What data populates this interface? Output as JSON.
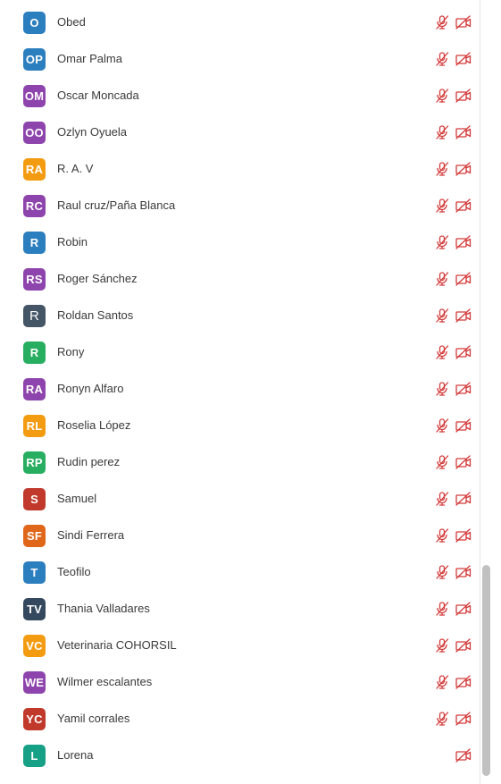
{
  "colors": {
    "blue": "#2c7fbf",
    "purple": "#8e44ad",
    "orange": "#f39c12",
    "slate": "#445566",
    "green": "#27ae60",
    "red": "#c0392b",
    "dark_orange": "#e0661a",
    "navy": "#34495e",
    "teal": "#16a085",
    "muted_icon": "#d33a3a"
  },
  "participants": [
    {
      "initials": "O",
      "name": "Obed",
      "color": "#2c7fbf",
      "mic_muted": true,
      "cam_off": true,
      "mic_icon": "microphone-muted-icon",
      "cam_icon": "camera-off-icon"
    },
    {
      "initials": "OP",
      "name": "Omar Palma",
      "color": "#2c7fbf",
      "mic_muted": true,
      "cam_off": true,
      "mic_icon": "microphone-muted-icon",
      "cam_icon": "camera-off-icon"
    },
    {
      "initials": "OM",
      "name": "Oscar Moncada",
      "color": "#8e44ad",
      "mic_muted": true,
      "cam_off": true,
      "mic_icon": "microphone-muted-icon",
      "cam_icon": "camera-off-icon"
    },
    {
      "initials": "OO",
      "name": "Ozlyn Oyuela",
      "color": "#8e44ad",
      "mic_muted": true,
      "cam_off": true,
      "mic_icon": "microphone-muted-icon",
      "cam_icon": "camera-off-icon"
    },
    {
      "initials": "RA",
      "name": "R. A. V",
      "color": "#f39c12",
      "mic_muted": true,
      "cam_off": true,
      "mic_icon": "microphone-muted-icon",
      "cam_icon": "camera-off-icon"
    },
    {
      "initials": "RC",
      "name": "Raul cruz/Paña Blanca",
      "color": "#8e44ad",
      "mic_muted": true,
      "cam_off": true,
      "mic_icon": "microphone-muted-icon",
      "cam_icon": "camera-off-icon"
    },
    {
      "initials": "R",
      "name": "Robin",
      "color": "#2c7fbf",
      "mic_muted": true,
      "cam_off": true,
      "mic_icon": "microphone-muted-icon",
      "cam_icon": "camera-off-icon"
    },
    {
      "initials": "RS",
      "name": "Roger Sánchez",
      "color": "#8e44ad",
      "mic_muted": true,
      "cam_off": true,
      "mic_icon": "microphone-muted-icon",
      "cam_icon": "camera-off-icon"
    },
    {
      "initials": "R",
      "name": "Roldan Santos",
      "color": "#445566",
      "light": true,
      "mic_muted": true,
      "cam_off": true,
      "mic_icon": "microphone-muted-icon",
      "cam_icon": "camera-off-icon"
    },
    {
      "initials": "R",
      "name": "Rony",
      "color": "#27ae60",
      "mic_muted": true,
      "cam_off": true,
      "mic_icon": "microphone-muted-icon",
      "cam_icon": "camera-off-icon"
    },
    {
      "initials": "RA",
      "name": "Ronyn Alfaro",
      "color": "#8e44ad",
      "mic_muted": true,
      "cam_off": true,
      "mic_icon": "microphone-muted-icon",
      "cam_icon": "camera-off-icon"
    },
    {
      "initials": "RL",
      "name": "Roselia López",
      "color": "#f39c12",
      "mic_muted": true,
      "cam_off": true,
      "mic_icon": "microphone-muted-icon",
      "cam_icon": "camera-off-icon"
    },
    {
      "initials": "RP",
      "name": "Rudin perez",
      "color": "#27ae60",
      "mic_muted": true,
      "cam_off": true,
      "mic_icon": "microphone-muted-icon",
      "cam_icon": "camera-off-icon"
    },
    {
      "initials": "S",
      "name": "Samuel",
      "color": "#c0392b",
      "mic_muted": true,
      "cam_off": true,
      "mic_icon": "microphone-muted-icon",
      "cam_icon": "camera-off-icon"
    },
    {
      "initials": "SF",
      "name": "Sindi Ferrera",
      "color": "#e0661a",
      "mic_muted": true,
      "cam_off": true,
      "mic_icon": "microphone-muted-icon",
      "cam_icon": "camera-off-icon"
    },
    {
      "initials": "T",
      "name": "Teofilo",
      "color": "#2c7fbf",
      "mic_muted": true,
      "cam_off": true,
      "mic_icon": "microphone-muted-icon",
      "cam_icon": "camera-off-icon"
    },
    {
      "initials": "TV",
      "name": "Thania Valladares",
      "color": "#34495e",
      "mic_muted": true,
      "cam_off": true,
      "mic_icon": "microphone-muted-icon",
      "cam_icon": "camera-off-icon"
    },
    {
      "initials": "VC",
      "name": "Veterinaria COHORSIL",
      "color": "#f39c12",
      "mic_muted": true,
      "cam_off": true,
      "mic_icon": "microphone-muted-icon",
      "cam_icon": "camera-off-icon"
    },
    {
      "initials": "WE",
      "name": "Wilmer escalantes",
      "color": "#8e44ad",
      "mic_muted": true,
      "cam_off": true,
      "mic_icon": "microphone-muted-icon",
      "cam_icon": "camera-off-icon"
    },
    {
      "initials": "YC",
      "name": "Yamil corrales",
      "color": "#c0392b",
      "mic_muted": true,
      "cam_off": true,
      "mic_icon": "microphone-muted-icon",
      "cam_icon": "camera-off-icon"
    },
    {
      "initials": "L",
      "name": "Lorena",
      "color": "#16a085",
      "mic_muted": false,
      "cam_off": true,
      "mic_icon": "",
      "cam_icon": "camera-off-icon"
    }
  ]
}
